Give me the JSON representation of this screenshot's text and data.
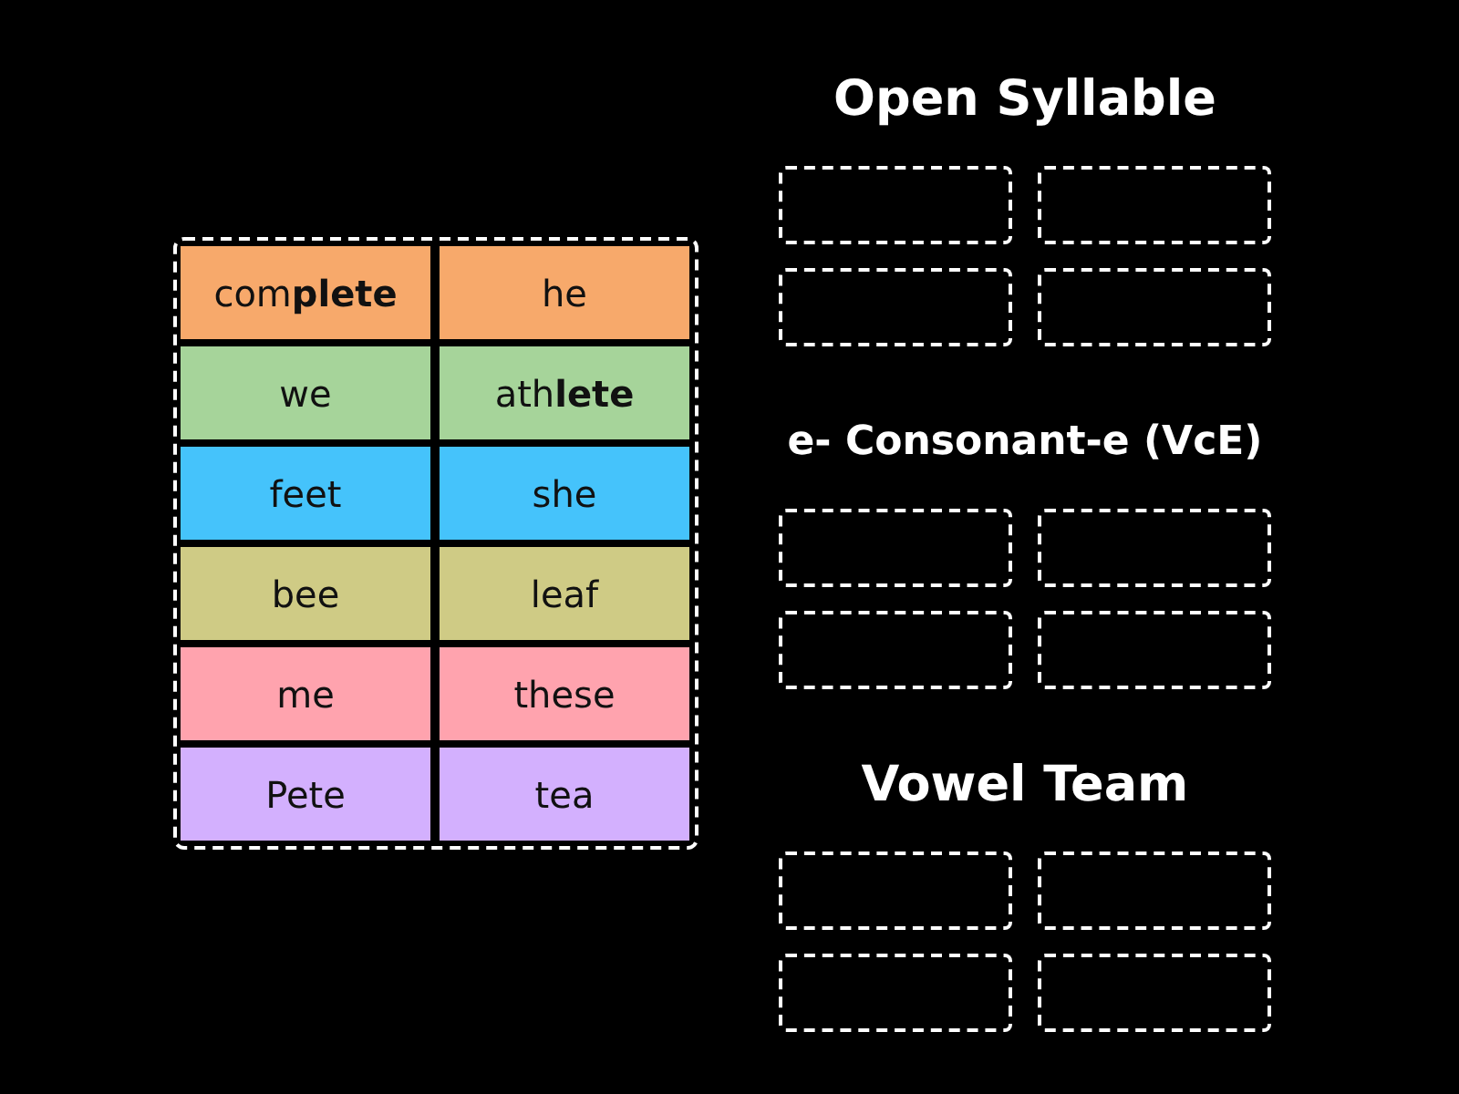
{
  "tiles": [
    {
      "text": "com**plete**",
      "color": "#f7a96b"
    },
    {
      "text": "he",
      "color": "#f7a96b"
    },
    {
      "text": "we",
      "color": "#a6d49a"
    },
    {
      "text": "ath**lete**",
      "color": "#a6d49a"
    },
    {
      "text": "feet",
      "color": "#45c3fb"
    },
    {
      "text": "she",
      "color": "#45c3fb"
    },
    {
      "text": "bee",
      "color": "#cfcb85"
    },
    {
      "text": "leaf",
      "color": "#cfcb85"
    },
    {
      "text": "me",
      "color": "#ffa3ae"
    },
    {
      "text": "these",
      "color": "#ffa3ae"
    },
    {
      "text": "Pete",
      "color": "#d3b0fe"
    },
    {
      "text": "tea",
      "color": "#d3b0fe"
    }
  ],
  "groups": [
    {
      "title": "Open Syllable",
      "drop_zones": [
        {
          "filled": false
        },
        {
          "filled": false
        },
        {
          "filled": false
        },
        {
          "filled": false
        }
      ]
    },
    {
      "title": "e- Consonant-e (VcE)",
      "drop_zones": [
        {
          "filled": false
        },
        {
          "filled": false
        },
        {
          "filled": false
        },
        {
          "filled": false
        }
      ]
    },
    {
      "title": "Vowel Team",
      "drop_zones": [
        {
          "filled": false
        },
        {
          "filled": false
        },
        {
          "filled": false
        },
        {
          "filled": false
        }
      ]
    }
  ]
}
